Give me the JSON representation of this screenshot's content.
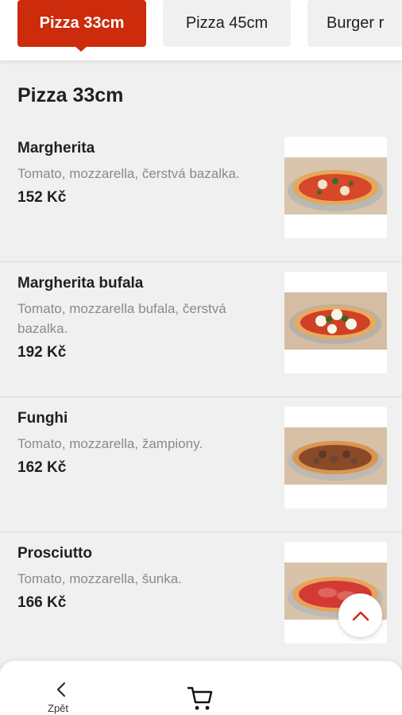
{
  "tabs": [
    {
      "label": "Pizza 33cm",
      "active": true
    },
    {
      "label": "Pizza 45cm",
      "active": false
    },
    {
      "label": "Burger r",
      "active": false
    }
  ],
  "section": {
    "title": "Pizza 33cm"
  },
  "items": [
    {
      "name": "Margherita",
      "description": "Tomato, mozzarella, čerstvá bazalka.",
      "price": "152 Kč"
    },
    {
      "name": "Margherita bufala",
      "description": "Tomato, mozzarella bufala, čerstvá bazalka.",
      "price": "192 Kč"
    },
    {
      "name": "Funghi",
      "description": "Tomato, mozzarella, žampiony.",
      "price": "162 Kč"
    },
    {
      "name": "Prosciutto",
      "description": "Tomato, mozzarella, šunka.",
      "price": "166 Kč"
    }
  ],
  "bottom_nav": {
    "back_label": "Zpět",
    "back_icon": "chevron-left-icon",
    "cart_icon": "cart-icon"
  },
  "scroll_top_icon": "chevron-up-icon",
  "colors": {
    "accent": "#cc2b0c",
    "background": "#f0f0f0",
    "text": "#1f1f1f",
    "muted": "#8a8a8a"
  }
}
